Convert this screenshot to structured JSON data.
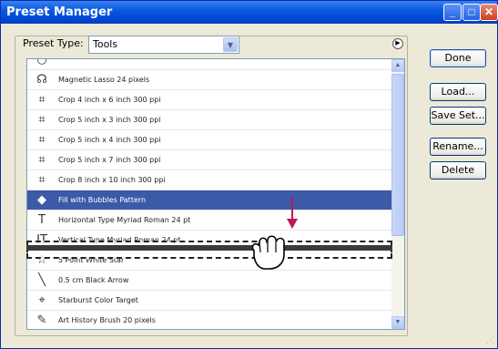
{
  "window": {
    "title": "Preset Manager",
    "min_label": "_",
    "max_label": "□",
    "close_label": "✕"
  },
  "preset_type": {
    "label": "Preset Type:",
    "value": "Tools",
    "arrow": "▼",
    "menu_arrow": "▶"
  },
  "list": {
    "items": [
      {
        "label": "",
        "icon": "partial-icon",
        "glyph": "○"
      },
      {
        "label": "Magnetic Lasso 24 pixels",
        "icon": "magnetic-lasso-icon",
        "glyph": "☊"
      },
      {
        "label": "Crop 4 inch x 6 inch 300 ppi",
        "icon": "crop-icon",
        "glyph": "⌗"
      },
      {
        "label": "Crop 5 inch x 3 inch 300 ppi",
        "icon": "crop-icon",
        "glyph": "⌗"
      },
      {
        "label": "Crop 5 inch x 4 inch 300 ppi",
        "icon": "crop-icon",
        "glyph": "⌗"
      },
      {
        "label": "Crop 5 inch x 7 inch 300 ppi",
        "icon": "crop-icon",
        "glyph": "⌗"
      },
      {
        "label": "Crop 8 inch x 10 inch 300 ppi",
        "icon": "crop-icon",
        "glyph": "⌗"
      },
      {
        "label": "Fill with Bubbles Pattern",
        "icon": "paint-bucket-icon",
        "glyph": "◆"
      },
      {
        "label": "Horizontal Type Myriad Roman 24 pt",
        "icon": "type-tool-icon",
        "glyph": "T"
      },
      {
        "label": "Vertical Type Myriad Roman 24 pt",
        "icon": "vertical-type-icon",
        "glyph": "IT"
      },
      {
        "label": "5 Point White Star",
        "icon": "star-shape-icon",
        "glyph": "☆"
      },
      {
        "label": "0.5 cm Black Arrow",
        "icon": "line-arrow-icon",
        "glyph": "╲"
      },
      {
        "label": "Starburst Color Target",
        "icon": "color-sampler-icon",
        "glyph": "⌖"
      },
      {
        "label": "Art History Brush 20 pixels",
        "icon": "art-history-brush-icon",
        "glyph": "✎"
      }
    ],
    "selected_index": 7,
    "scroll_up": "▲",
    "scroll_down": "▼"
  },
  "buttons": {
    "done": "Done",
    "load": "Load...",
    "save_set": "Save Set...",
    "rename": "Rename...",
    "delete": "Delete"
  },
  "colors": {
    "selection": "#3b5ba8",
    "title_bar": "#0a5ae0",
    "drag_arrow": "#c0185a"
  }
}
